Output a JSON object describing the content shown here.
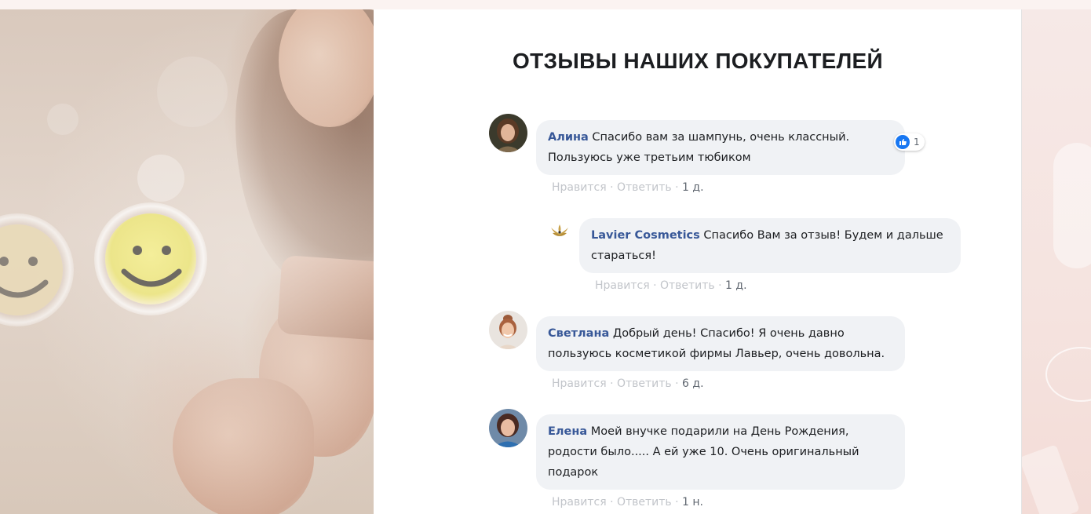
{
  "page": {
    "title": "ОТЗЫВЫ НАШИХ ПОКУПАТЕЛЕЙ"
  },
  "comments": [
    {
      "author": "Алина",
      "text_line1": "Спасибо вам за шампунь, очень классный.",
      "text_line2": "Пользуюсь уже третьим тюбиком",
      "like": "Нравится",
      "reply": "Ответить",
      "time": "1 д.",
      "reactions": "1",
      "reply_comment": {
        "author": "Lavier Cosmetics",
        "text_line1": "Спасибо Вам за отзыв! Будем и дальше",
        "text_line2": "стараться!",
        "like": "Нравится",
        "reply": "Ответить",
        "time": "1 д."
      }
    },
    {
      "author": "Светлана",
      "text_line1": "Добрый день! Спасибо! Я очень давно",
      "text_line2": "пользуюсь косметикой фирмы Лавьер, очень довольна.",
      "like": "Нравится",
      "reply": "Ответить",
      "time": "6 д."
    },
    {
      "author": "Елена",
      "text_line1": "Моей внучке подарили на День Рождения,",
      "text_line2": "родости было..... А ей уже 10. Очень оригинальный",
      "text_line3": "подарок",
      "like": "Нравится",
      "reply": "Ответить",
      "time": "1 н."
    }
  ],
  "separator": " · ",
  "colors": {
    "author_link": "#385898",
    "bubble_bg": "#f0f2f5",
    "like_blue": "#1877f2",
    "muted_action": "#c2c5ca"
  },
  "icons": {
    "reaction": "thumbs-up-icon",
    "brand": "lotus-logo-icon"
  }
}
